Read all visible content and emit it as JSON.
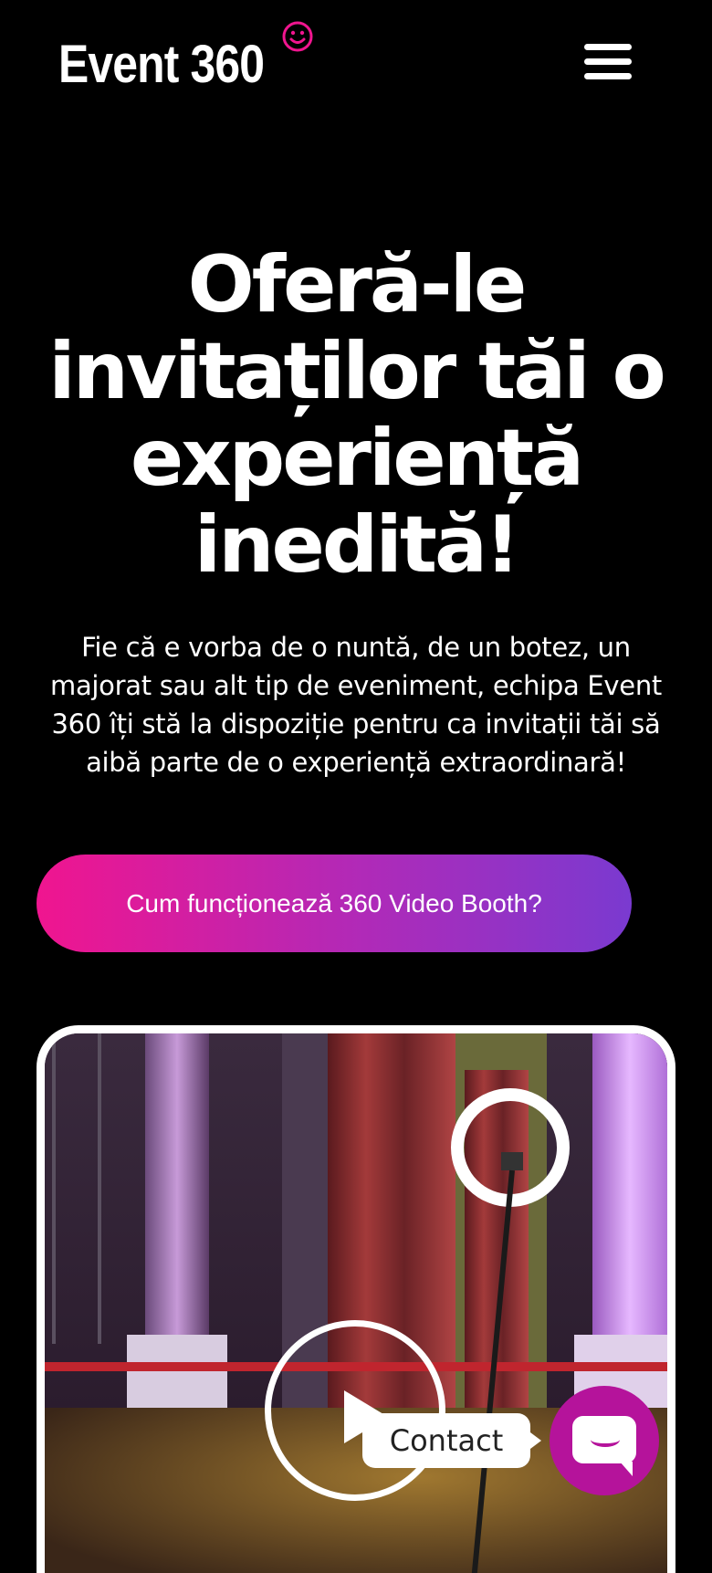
{
  "header": {
    "logo_text": "Event 360",
    "logo_icon": "smiley-icon",
    "menu_icon": "hamburger-menu-icon"
  },
  "hero": {
    "title": "Oferă-le invitaților tăi o experiență inedită!",
    "description": "Fie că e vorba de o nuntă, de un botez, un majorat sau alt tip de eveniment, echipa Event 360 îți stă la dispoziție pentru ca invitații tăi să aibă parte de o experiență extraordinară!",
    "cta_label": "Cum funcționează 360 Video Booth?"
  },
  "video": {
    "play_icon": "play-icon"
  },
  "contact_widget": {
    "tooltip": "Contact",
    "icon": "chat-bubble-icon"
  },
  "colors": {
    "background": "#000000",
    "accent_pink": "#f0158f",
    "accent_purple": "#7a3ad0",
    "chat_button": "#b5139b"
  }
}
